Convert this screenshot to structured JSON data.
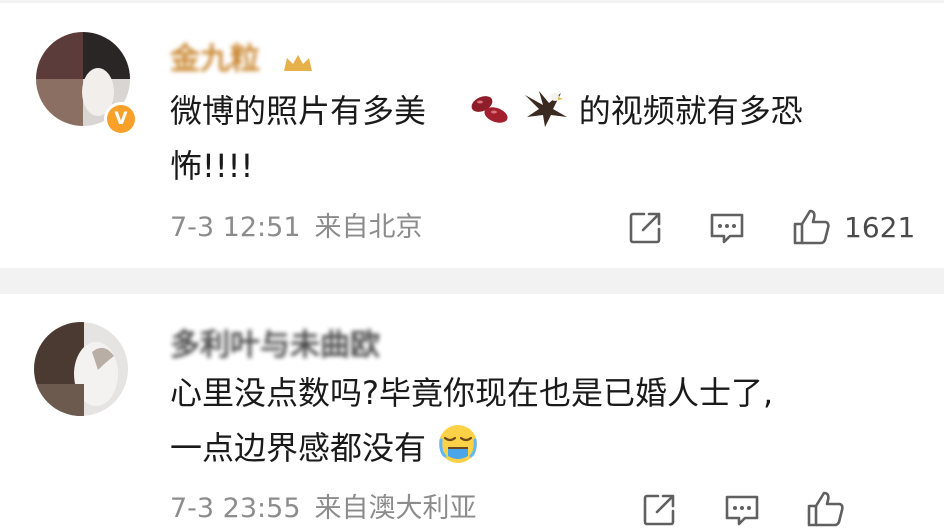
{
  "comments": [
    {
      "username": "金九粒",
      "content_line1": "微博的照片有多美",
      "content_line1_tail": "的视频就有多恐",
      "content_line2": "怖!!!!",
      "date": "7-3 12:51",
      "location": "来自北京",
      "likes": "1621"
    },
    {
      "username": "多利叶与未曲欧",
      "content_line1": "心里没点数吗?毕竟你现在也是已婚人士了,",
      "content_line2": "一点边界感都没有",
      "date": "7-3 23:55",
      "location": "来自澳大利亚",
      "likes": ""
    }
  ],
  "colors": {
    "separator": "#f2f2f2",
    "meta_text": "#8c8c8c",
    "badge": "#f7a02a"
  },
  "icons": [
    "share-icon",
    "comment-icon",
    "like-icon",
    "verified-badge-icon",
    "kidney-beans-emoji",
    "eagle-emoji",
    "crying-face-emoji",
    "crown-icon"
  ]
}
